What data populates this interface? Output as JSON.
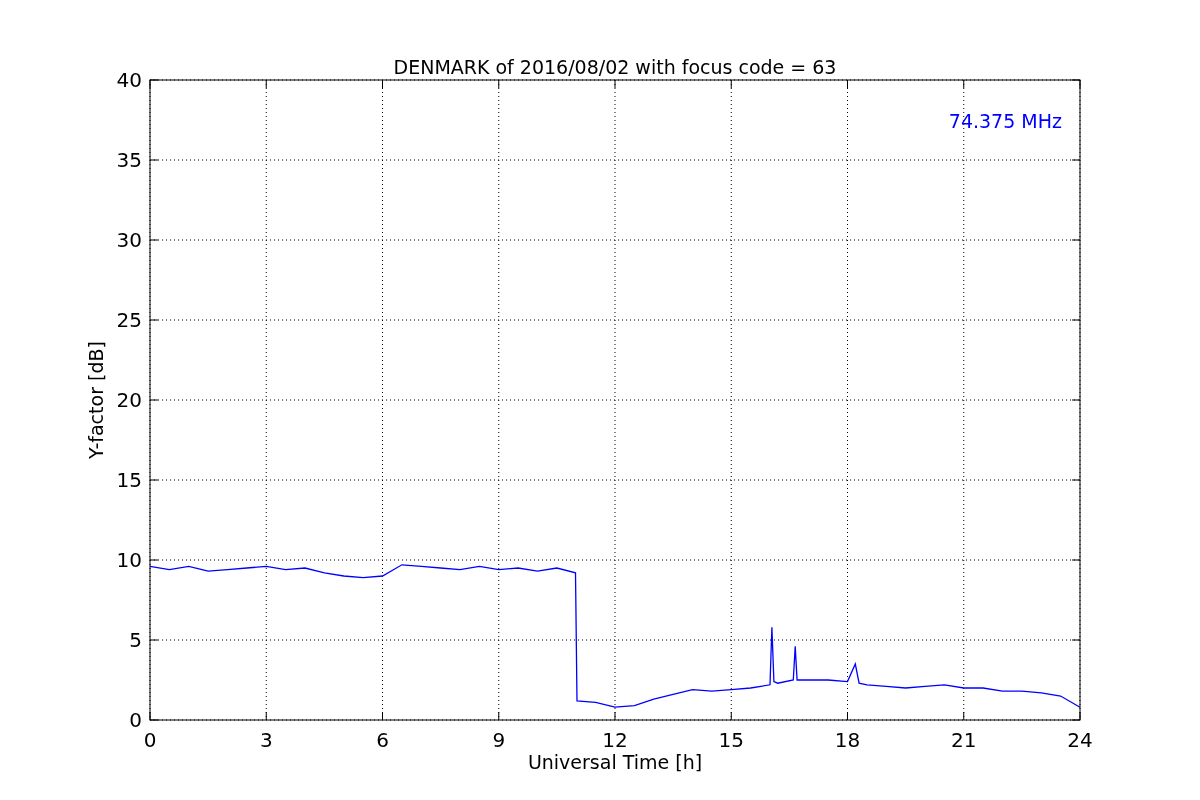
{
  "chart_data": {
    "type": "line",
    "title": "DENMARK of 2016/08/02 with focus code = 63",
    "xlabel": "Universal Time [h]",
    "ylabel": "Y-factor [dB]",
    "x": [
      0,
      0.5,
      1,
      1.5,
      2,
      2.5,
      3,
      3.5,
      4,
      4.5,
      5,
      5.5,
      6,
      6.5,
      7,
      7.5,
      8,
      8.5,
      9,
      9.5,
      10,
      10.5,
      10.98,
      11.02,
      11.5,
      12,
      12.5,
      13,
      13.5,
      14,
      14.5,
      15,
      15.5,
      16,
      16.05,
      16.1,
      16.2,
      16.6,
      16.65,
      16.7,
      17,
      17.5,
      18,
      18.2,
      18.3,
      18.5,
      19,
      19.5,
      20,
      20.5,
      21,
      21.5,
      22,
      22.5,
      23,
      23.5,
      24
    ],
    "series": [
      {
        "color": "#0000ff",
        "values": [
          9.6,
          9.4,
          9.6,
          9.3,
          9.4,
          9.5,
          9.6,
          9.4,
          9.5,
          9.2,
          9.0,
          8.9,
          9.0,
          9.7,
          9.6,
          9.5,
          9.4,
          9.6,
          9.4,
          9.5,
          9.3,
          9.5,
          9.2,
          1.2,
          1.1,
          0.8,
          0.9,
          1.3,
          1.6,
          1.9,
          1.8,
          1.9,
          2.0,
          2.2,
          5.8,
          2.4,
          2.3,
          2.5,
          4.6,
          2.5,
          2.5,
          2.5,
          2.4,
          3.5,
          2.3,
          2.2,
          2.1,
          2.0,
          2.1,
          2.2,
          2.0,
          2.0,
          1.8,
          1.8,
          1.7,
          1.5,
          0.8
        ]
      }
    ],
    "xlim": [
      0,
      24
    ],
    "ylim": [
      0,
      40
    ],
    "xticks": [
      0,
      3,
      6,
      9,
      12,
      15,
      18,
      21,
      24
    ],
    "yticks": [
      0,
      5,
      10,
      15,
      20,
      25,
      30,
      35,
      40
    ],
    "grid": true,
    "annotations": [
      {
        "text": "74.375 MHz"
      }
    ]
  }
}
